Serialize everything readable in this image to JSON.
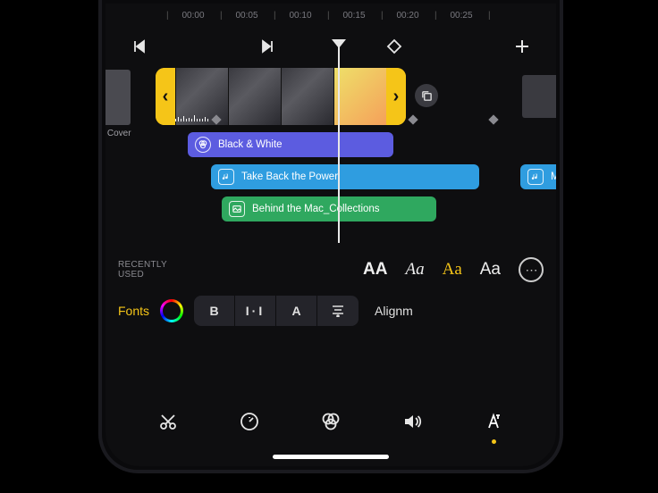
{
  "ruler": {
    "labels": [
      "00:00",
      "00:05",
      "00:10",
      "00:15",
      "00:20",
      "00:25"
    ]
  },
  "timeline": {
    "side_clip_label": "ge Cover",
    "effect": {
      "label": "Black & White",
      "color": "#5c5ce0"
    },
    "audio": {
      "label": "Take Back the Power",
      "color": "#2f9de0",
      "extra_label": "M"
    },
    "overlay": {
      "label": "Behind the Mac_Collections",
      "color": "#2fa85f"
    }
  },
  "fonts_panel": {
    "recent_label": "RECENTLY\nUSED",
    "samples": {
      "s1": "AA",
      "s2": "Aa",
      "s3": "Aa",
      "s4": "Aa"
    },
    "more": "⋯",
    "fonts_label": "Fonts",
    "bold": "B",
    "spacing": "H",
    "caps": "A",
    "align_label": "Alignm"
  },
  "icons": {
    "prev": "prev",
    "next": "next",
    "keyframe": "keyframe",
    "add": "add",
    "copy": "copy",
    "scissors": "scissors",
    "gauge": "gauge",
    "filters": "filters",
    "volume": "volume",
    "text": "text"
  }
}
